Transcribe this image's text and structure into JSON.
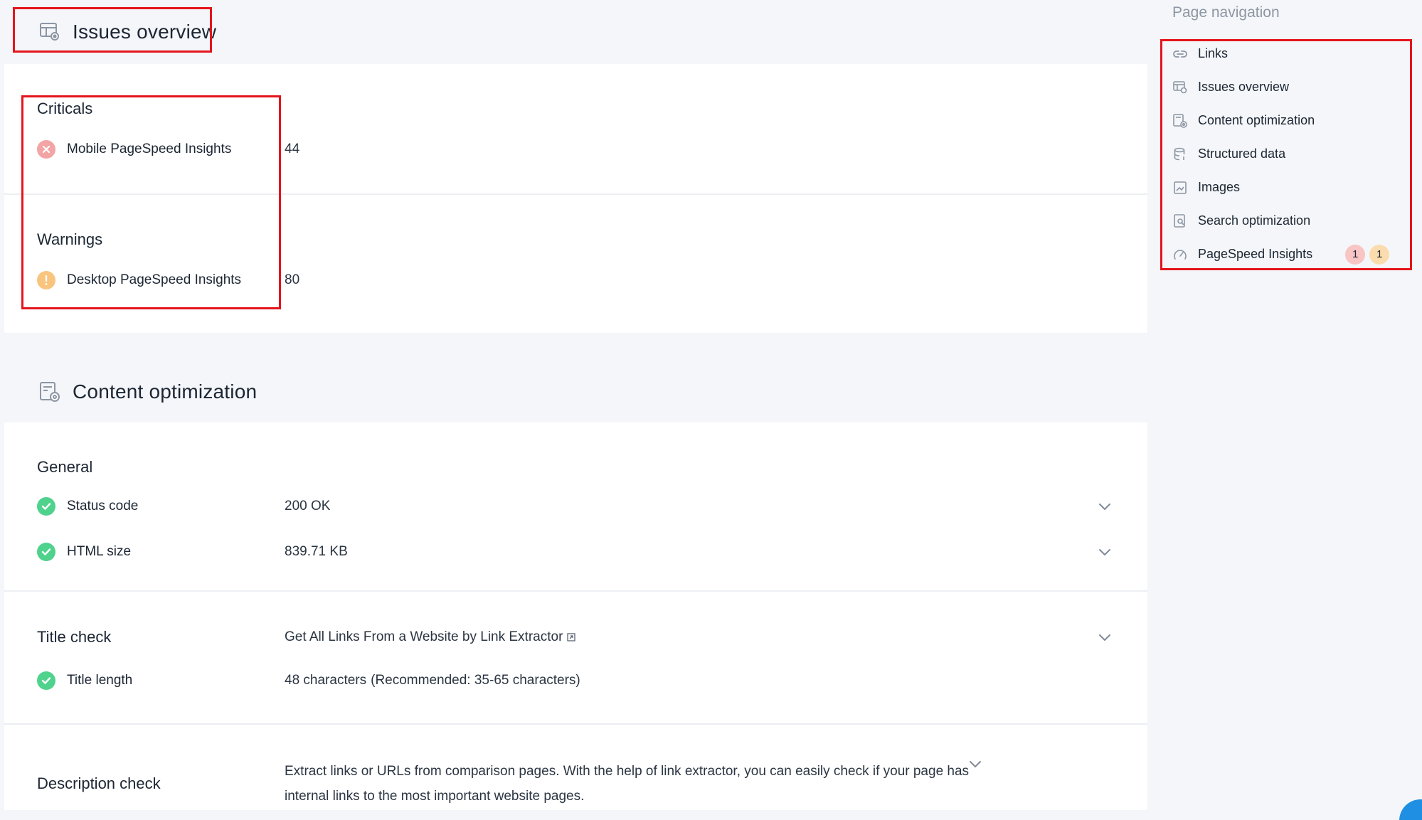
{
  "issues_section": {
    "title": "Issues overview",
    "criticals": {
      "title": "Criticals",
      "items": [
        {
          "label": "Mobile PageSpeed Insights",
          "value": "44"
        }
      ]
    },
    "warnings": {
      "title": "Warnings",
      "items": [
        {
          "label": "Desktop PageSpeed Insights",
          "value": "80"
        }
      ]
    }
  },
  "content_section": {
    "title": "Content optimization",
    "general": {
      "title": "General",
      "status_code": {
        "label": "Status code",
        "value": "200 OK"
      },
      "html_size": {
        "label": "HTML size",
        "value": "839.71 KB"
      }
    },
    "title_check": {
      "title": "Title check",
      "value": "Get All Links From a Website by Link Extractor",
      "title_length": {
        "label": "Title length",
        "value": "48 characters",
        "hint": "(Recommended: 35-65 characters)"
      }
    },
    "description_check": {
      "title": "Description check",
      "value_line1": "Extract links or URLs from comparison pages. With the help of link extractor, you can easily check if your page has",
      "value_line2": "internal links to the most important website pages."
    }
  },
  "sidebar": {
    "title": "Page navigation",
    "items": [
      {
        "label": "Links",
        "icon": "link-icon"
      },
      {
        "label": "Issues overview",
        "icon": "issues-icon"
      },
      {
        "label": "Content optimization",
        "icon": "content-icon"
      },
      {
        "label": "Structured data",
        "icon": "database-icon"
      },
      {
        "label": "Images",
        "icon": "image-icon"
      },
      {
        "label": "Search optimization",
        "icon": "search-doc-icon"
      },
      {
        "label": "PageSpeed Insights",
        "icon": "speed-icon"
      }
    ],
    "pagespeed_badges": {
      "critical": "1",
      "warning": "1"
    }
  },
  "colors": {
    "critical": "#f3a4a4",
    "warning": "#f9c57e",
    "ok": "#4fd28c",
    "annotation": "#e5141b"
  }
}
